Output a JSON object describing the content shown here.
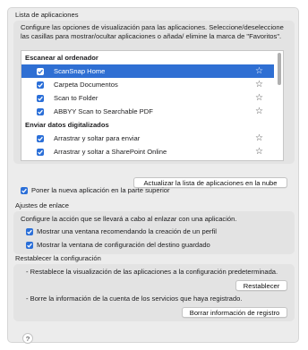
{
  "app_list": {
    "title": "Lista de aplicaciones",
    "description": "Configure las opciones de visualización para las aplicaciones. Seleccione/deseleccione las casillas para mostrar/ocultar aplicaciones o añada/ elimine la marca de \"Favoritos\".",
    "groups": [
      {
        "header": "Escanear al ordenador",
        "items": [
          {
            "label": "ScanSnap Home",
            "checked": true,
            "selected": true
          },
          {
            "label": "Carpeta Documentos",
            "checked": true,
            "selected": false
          },
          {
            "label": "Scan to Folder",
            "checked": true,
            "selected": false
          },
          {
            "label": "ABBYY Scan to Searchable PDF",
            "checked": true,
            "selected": false
          }
        ]
      },
      {
        "header": "Enviar datos digitalizados",
        "items": [
          {
            "label": "Arrastrar y soltar para enviar",
            "checked": true,
            "selected": false
          },
          {
            "label": "Arrastrar y soltar a SharePoint Online",
            "checked": true,
            "selected": false
          }
        ]
      }
    ],
    "update_button": "Actualizar la lista de aplicaciones en la nube",
    "new_app_top": {
      "label": "Poner la nueva aplicación en la parte superior",
      "checked": true
    }
  },
  "link_settings": {
    "title": "Ajustes de enlace",
    "description": "Configure la acción que se llevará a cabo al enlazar con una aplicación.",
    "options": [
      {
        "label": "Mostrar una ventana recomendando la creación de un perfil",
        "checked": true
      },
      {
        "label": "Mostrar la ventana de configuración del destino guardado",
        "checked": true
      }
    ]
  },
  "restore": {
    "title": "Restablecer la configuración",
    "restore_desc": "- Restablece la visualización de las aplicaciones a la configuración predeterminada.",
    "restore_button": "Restablecer",
    "delete_desc": "- Borre la información de la cuenta de los servicios que haya registrado.",
    "delete_button": "Borrar información de registro"
  },
  "help_button": "?",
  "colors": {
    "accent": "#2f6fd3",
    "panel": "#ececec",
    "group": "#e3e3e3"
  },
  "icons": {
    "favorite": "star-outline-icon",
    "checkbox": "checkmark-icon"
  }
}
